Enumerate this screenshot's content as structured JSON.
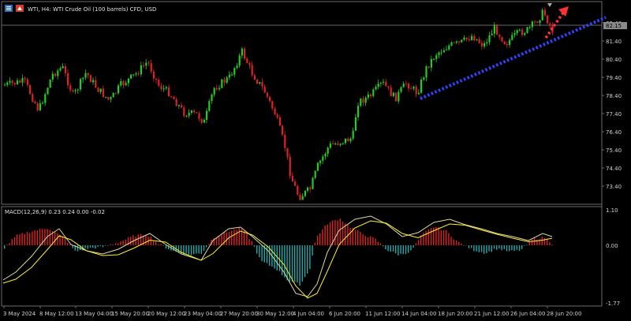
{
  "header": {
    "symbol_title": "WTI, H4: WTI Crude Oil (100 barrels) CFD, USD"
  },
  "price_axis": {
    "ticks": [
      "82.40",
      "81.40",
      "80.40",
      "79.40",
      "78.40",
      "77.40",
      "76.40",
      "75.40",
      "74.40",
      "73.40"
    ],
    "current_price": "82.15"
  },
  "macd": {
    "title": "MACD(12,26,9) 0.23 0.24 0.00 -0.02",
    "ticks": [
      "1.10",
      "0.00",
      "-1.77"
    ]
  },
  "time_axis": {
    "labels": [
      "3 May 2024",
      "8 May 12:00",
      "13 May 04:00",
      "15 May 20:00",
      "20 May 12:00",
      "23 May 04:00",
      "27 May 20:00",
      "30 May 12:00",
      "4 Jun 04:00",
      "6 Jun 20:00",
      "11 Jun 12:00",
      "14 Jun 04:00",
      "18 Jun 20:00",
      "21 Jun 12:00",
      "26 Jun 04:00",
      "28 Jun 20:00"
    ]
  },
  "colors": {
    "bull": "#22cc22",
    "bear": "#dd2222",
    "trendline": "#3344ff",
    "arrow": "#ff3333",
    "macd_line": "#e0d8a0",
    "signal_line": "#ffee33",
    "hist_pos": "#dd2222",
    "hist_neg": "#22aaaa"
  },
  "icons": {
    "menu": "chart-menu-icon",
    "symbol": "symbol-flag-icon"
  }
}
